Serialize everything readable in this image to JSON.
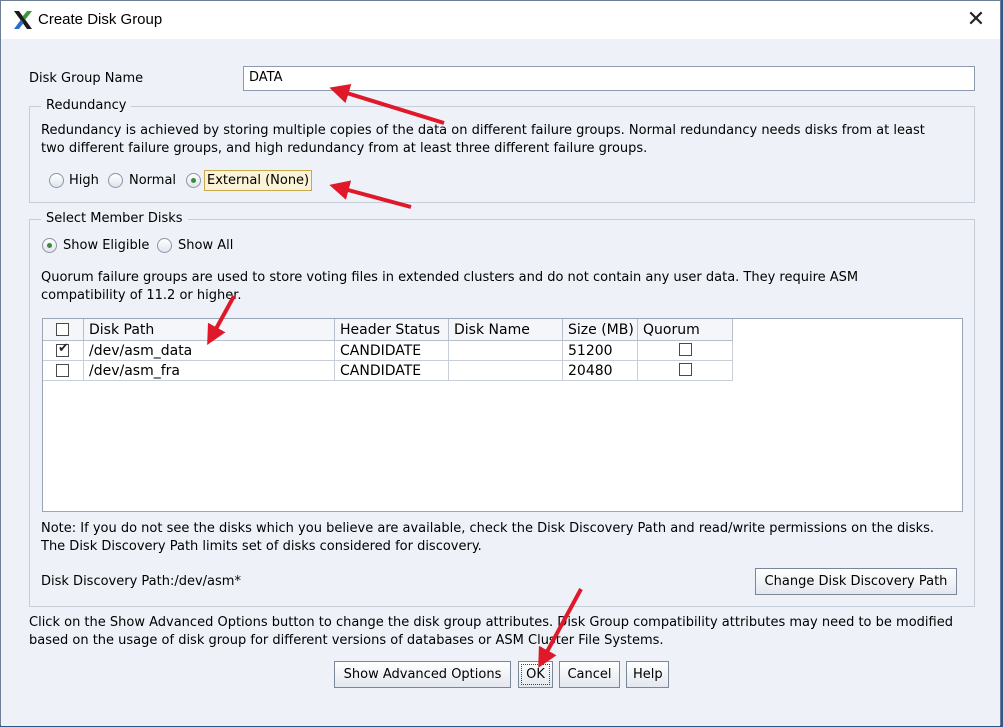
{
  "window": {
    "title": "Create Disk Group"
  },
  "disk_group_name": {
    "label": "Disk Group Name",
    "value": "DATA"
  },
  "redundancy": {
    "legend": "Redundancy",
    "description_line1": "Redundancy is achieved by storing multiple copies of the data on different failure groups. Normal redundancy needs disks from at least",
    "description_line2": "two different failure groups, and high redundancy from at least three different failure groups.",
    "options": [
      {
        "label": "High",
        "selected": false
      },
      {
        "label": "Normal",
        "selected": false
      },
      {
        "label": "External (None)",
        "selected": true
      }
    ]
  },
  "member_disks": {
    "legend": "Select Member Disks",
    "show_options": [
      {
        "label": "Show Eligible",
        "selected": true
      },
      {
        "label": "Show All",
        "selected": false
      }
    ],
    "quorum_note_line1": "Quorum failure groups are used to store voting files in extended clusters and do not contain any user data. They require ASM",
    "quorum_note_line2": "compatibility of 11.2 or higher.",
    "columns": [
      "Disk Path",
      "Header Status",
      "Disk Name",
      "Size (MB)",
      "Quorum"
    ],
    "rows": [
      {
        "selected": true,
        "path": "/dev/asm_data",
        "status": "CANDIDATE",
        "name": "",
        "size": "51200",
        "quorum": false
      },
      {
        "selected": false,
        "path": "/dev/asm_fra",
        "status": "CANDIDATE",
        "name": "",
        "size": "20480",
        "quorum": false
      }
    ],
    "note_line1": "Note: If you do not see the disks which you believe are available, check the Disk Discovery Path and read/write permissions on the disks.",
    "note_line2": "The Disk Discovery Path limits set of disks considered for discovery.",
    "discovery_path": "Disk Discovery Path:/dev/asm*",
    "change_path_button": "Change Disk Discovery Path"
  },
  "advanced_note_line1": "Click on the Show Advanced Options button to change the disk group attributes. Disk Group compatibility attributes may need to be modified",
  "advanced_note_line2": "based on the usage of disk group for different versions of databases or ASM Cluster File Systems.",
  "buttons": {
    "advanced": "Show Advanced Options",
    "ok": "OK",
    "cancel": "Cancel",
    "help": "Help"
  },
  "colors": {
    "annotation_arrow": "#e0192a",
    "radio_selected": "#3d8a3d"
  }
}
